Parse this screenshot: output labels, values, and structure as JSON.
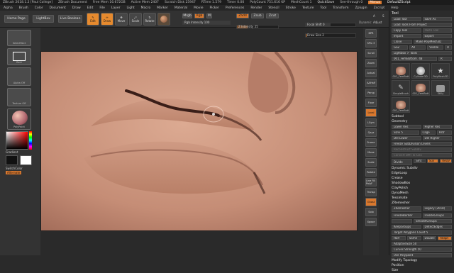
{
  "titlebar": {
    "app": "ZBrush 2018.1.2 [Paul College]",
    "document": "ZBrush Document",
    "free_mem": "Free Mem 16.672GB",
    "active_mem": "Active Mem 2407",
    "scratch": "Scratch Disk 25947",
    "rtime": "RTime 1.579",
    "timer": "Timer 0.00",
    "poly_count": "PolyCount 751.616 KP",
    "mesh_count": "MeshCount 1",
    "quicksave": "QuickSave",
    "see_through": "See-through 0",
    "menus_label": "Menus",
    "default_script": "DefaultZScript"
  },
  "menubar": {
    "items": [
      "Alpha",
      "Brush",
      "Color",
      "Document",
      "Draw",
      "Edit",
      "File",
      "Layer",
      "Light",
      "Macro",
      "Marker",
      "Material",
      "Movie",
      "Picker",
      "Preferences",
      "Render",
      "Stencil",
      "Stroke",
      "Texture",
      "Tool",
      "Transform",
      "Zplugin",
      "Zscript",
      "Help"
    ]
  },
  "topshelf": {
    "home_page": "Home Page",
    "lightbox": "LightBox",
    "live_boolean": "Live Boolean",
    "edit": "Edit",
    "draw": "Draw",
    "move": "Move",
    "scale": "Scale",
    "rotate": "Rotate",
    "mrgb": "Mrgb",
    "rgb": "Rgb",
    "m": "M",
    "rgb_intensity": "Rgb Intensity 100",
    "zadd": "Zadd",
    "zsub": "Zsub",
    "zcut": "Zcut",
    "z_intensity": "Z Intensity 25",
    "focal_shift": "Focal Shift 0",
    "draw_size": "Draw Size 2",
    "dynamic": "Dynamic",
    "a": "A",
    "adjust": "Adjust",
    "s": "S"
  },
  "leftshelf": {
    "brush": "SelectRect",
    "stroke": "Rect",
    "alpha": "Alpha Off",
    "texture": "Texture Off",
    "material": "PolyPaint",
    "gradient": "Gradient",
    "switch_color": "SwitchColor",
    "alternate": "Alternate"
  },
  "rightshelf": {
    "buttons": [
      "BPR",
      "SPix 3",
      "Scroll",
      "Zoom",
      "Actual",
      "AAHalf",
      "Persp",
      "Floor",
      "Local",
      "LSym",
      "Qxyz",
      "",
      "",
      "",
      "Frame",
      "Move",
      "Scale",
      "Rotate",
      "Line Fill PolyF",
      "Transp",
      "Ghost",
      "Solo",
      "Xpose"
    ]
  },
  "tray": {
    "title": "Tool",
    "load_tool": "Load Tool",
    "save_as": "Save As",
    "load_tools_from_project": "Load Tools From Project",
    "copy_tool": "Copy Tool",
    "paste_tool": "Paste Tool",
    "import": "Import",
    "export": "Export",
    "clone": "Clone",
    "make_polymesh": "Make PolyMesh3D",
    "goz": "GoZ",
    "all": "All",
    "visible": "Visible",
    "r": "R",
    "lightbox_tools": "Lightbox > Tools",
    "current_tool": "001_FemBottom.",
    "current_tool_value": "48",
    "r2": "R",
    "thumbs": [
      "001_FemBott",
      "Cylinder3D",
      "PolyMesh3D",
      "SimpleBrush",
      "001_FemBott",
      "Stilly",
      "001_FemBott",
      "001_Cylinder"
    ],
    "subtool": "Subtool",
    "geometry": "Geometry",
    "lower_res": "Lower Res",
    "higher_res": "Higher Res",
    "sdiv": "SDiv 5",
    "cage": "Cage",
    "rstr": "Rstr",
    "del_lower": "Del Lower",
    "del_higher": "Del Higher",
    "freeze_subdiv": "Freeze SubDivision Levels",
    "reconstruct_subdiv": "Reconstruct Subdiv",
    "convert_bpr": "Convert BPR To Geo",
    "divide": "Divide",
    "smt": "Smt",
    "suv": "Suv",
    "reuv": "ReUV",
    "dynamic_subdiv": "Dynamic Subdiv",
    "edgeloop": "EdgeLoop",
    "crease": "Crease",
    "shadowbox": "ShadowBox",
    "clay_polish": "ClayPolish",
    "dynamesh": "DynaMesh",
    "tessimate": "Tessimate",
    "zremesher": "ZRemesher",
    "zremesher_btn": "ZRemesher",
    "legacy": "Legacy (2018)",
    "freeze_border": "FreezeBorder",
    "freeze_groups": "FreezeGroups",
    "smooth_groups": "SmoothGroups",
    "keep_groups": "KeepGroups",
    "detect_edges": "DetectEdges",
    "target_polygons": "Target Polygons Count 5",
    "half": "Half",
    "same": "Same",
    "double": "Double",
    "adapt": "Adapt",
    "adaptive_size": "AdaptiveSize 50",
    "curves_strength": "Curves Strength 50",
    "use_polypaint": "Use Polypaint",
    "modify_topology": "Modify Topology",
    "position": "Position",
    "size": "Size"
  }
}
